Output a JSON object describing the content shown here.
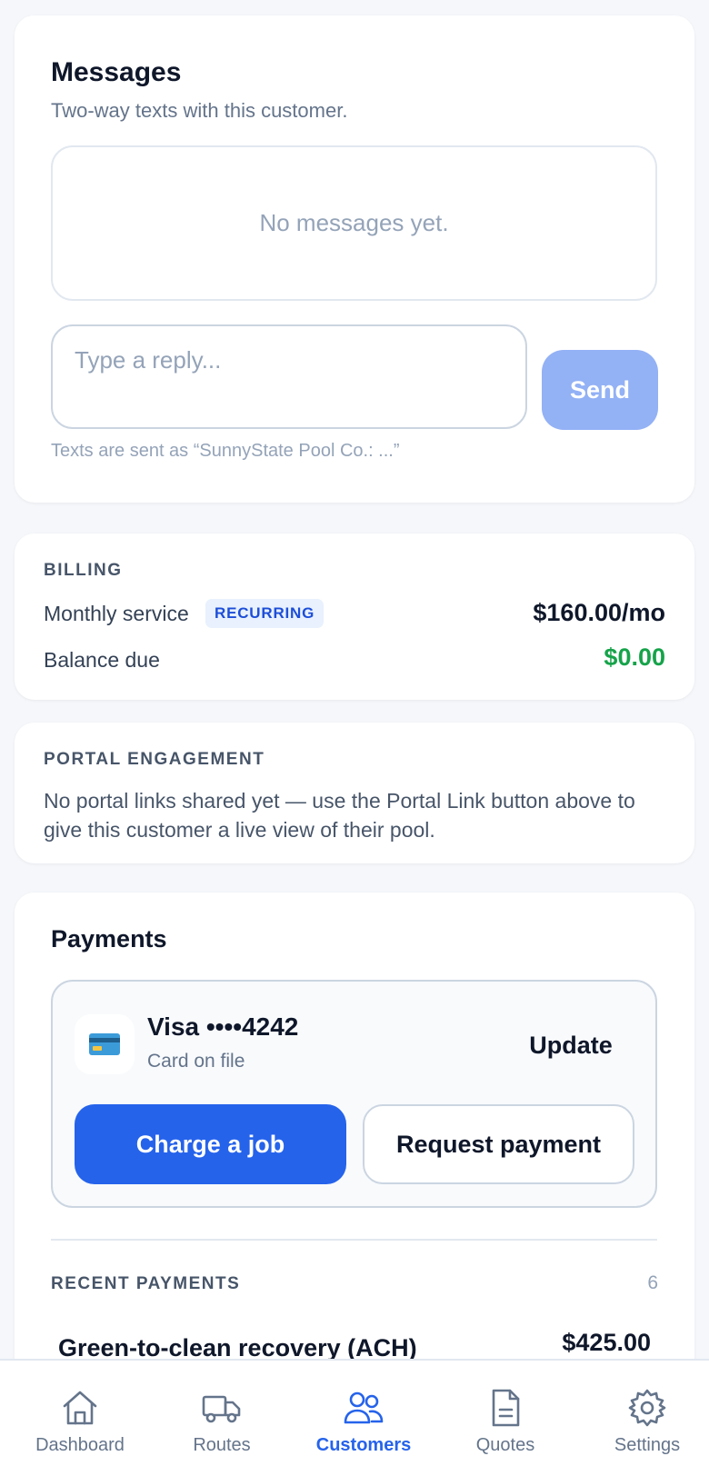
{
  "messages": {
    "title": "Messages",
    "subtitle": "Two-way texts with this customer.",
    "empty_text": "No messages yet.",
    "reply_placeholder": "Type a reply...",
    "send_label": "Send",
    "hint": "Texts are sent as “SunnyState Pool Co.: ...”"
  },
  "billing": {
    "section_label": "BILLING",
    "monthly_label": "Monthly service",
    "badge": "RECURRING",
    "monthly_amount": "$160.00/mo",
    "balance_label": "Balance due",
    "balance_amount": "$0.00",
    "balance_color": "#16a34a"
  },
  "portal": {
    "section_label": "PORTAL ENGAGEMENT",
    "text": "No portal links shared yet — use the Portal Link button above to give this customer a live view of their pool."
  },
  "payments": {
    "title": "Payments",
    "card_icon": "credit-card-icon",
    "card_brand": "Visa ••••4242",
    "card_sub": "Card on file",
    "update_label": "Update",
    "charge_label": "Charge a job",
    "request_label": "Request payment",
    "recent_label": "RECENT PAYMENTS",
    "recent_count": "6",
    "rows": [
      {
        "name": "Green-to-clean recovery (ACH)",
        "amount": "$425.00"
      }
    ]
  },
  "nav": {
    "active_color": "#2563eb",
    "items": [
      {
        "label": "Dashboard",
        "icon": "home-icon"
      },
      {
        "label": "Routes",
        "icon": "truck-icon"
      },
      {
        "label": "Customers",
        "icon": "users-icon"
      },
      {
        "label": "Quotes",
        "icon": "document-icon"
      },
      {
        "label": "Settings",
        "icon": "gear-icon"
      }
    ]
  }
}
